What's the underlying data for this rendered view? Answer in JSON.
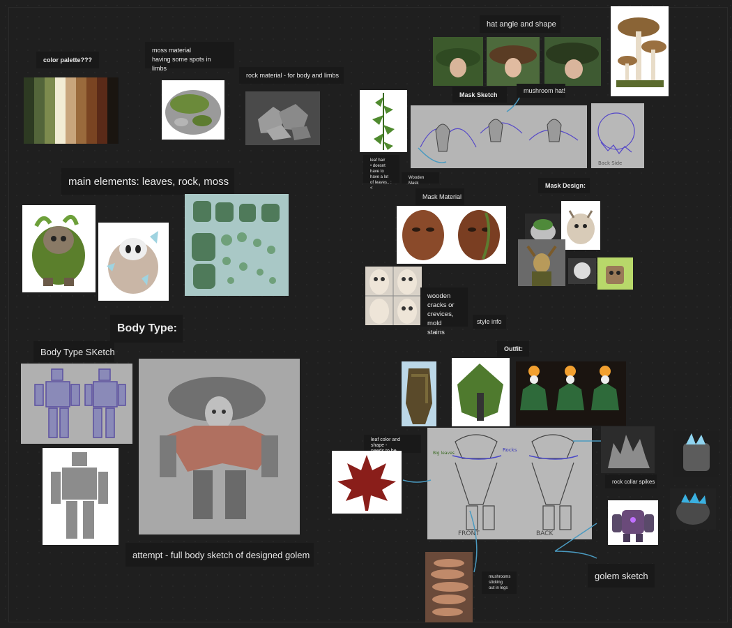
{
  "board": {
    "labels": {
      "color_palette": "color palette???",
      "moss_material": "moss material\nhaving some spots in limbs",
      "rock_material": "rock material - for body and limbs",
      "main_elements": "main elements: leaves, rock, moss",
      "body_type": "Body Type:",
      "body_type_sketch": "Body Type SKetch",
      "attempt": "attempt - full body sketch of designed golem",
      "hat_angle": "hat angle and shape",
      "mask_sketch": "Mask Sketch",
      "mushroom_hat": "mushroom hat!",
      "leaf_hair": "leaf hair\n• doesnt have to have a lot of leaves.. :<",
      "wooden_mask": "Wooden Mask",
      "mask_material": "Mask Material",
      "mask_design": "Mask Design:",
      "wooden_cracks": "wooden\ncracks or\ncrevices,\nmold stains",
      "style_info": "style info",
      "outfit": "Outfit:",
      "leaf_color": "leaf color and shape -\nneeds to be elongated",
      "rock_collar": "rock collar spikes",
      "mushrooms_legs": "mushrooms\nsticking\nout in legs",
      "golem_sketch": "golem sketch"
    },
    "sketch_annotations": {
      "front": "FRONT",
      "back": "BACK",
      "rocks": "Rocks",
      "big_leaves": "Big leaves",
      "back_side": "Back Side"
    },
    "palette_colors": [
      "#2d3a22",
      "#53653a",
      "#7d8b4e",
      "#f2ecd4",
      "#c8a57c",
      "#9a6a3c",
      "#7a4422",
      "#5a2a18",
      "#1a1510"
    ]
  }
}
